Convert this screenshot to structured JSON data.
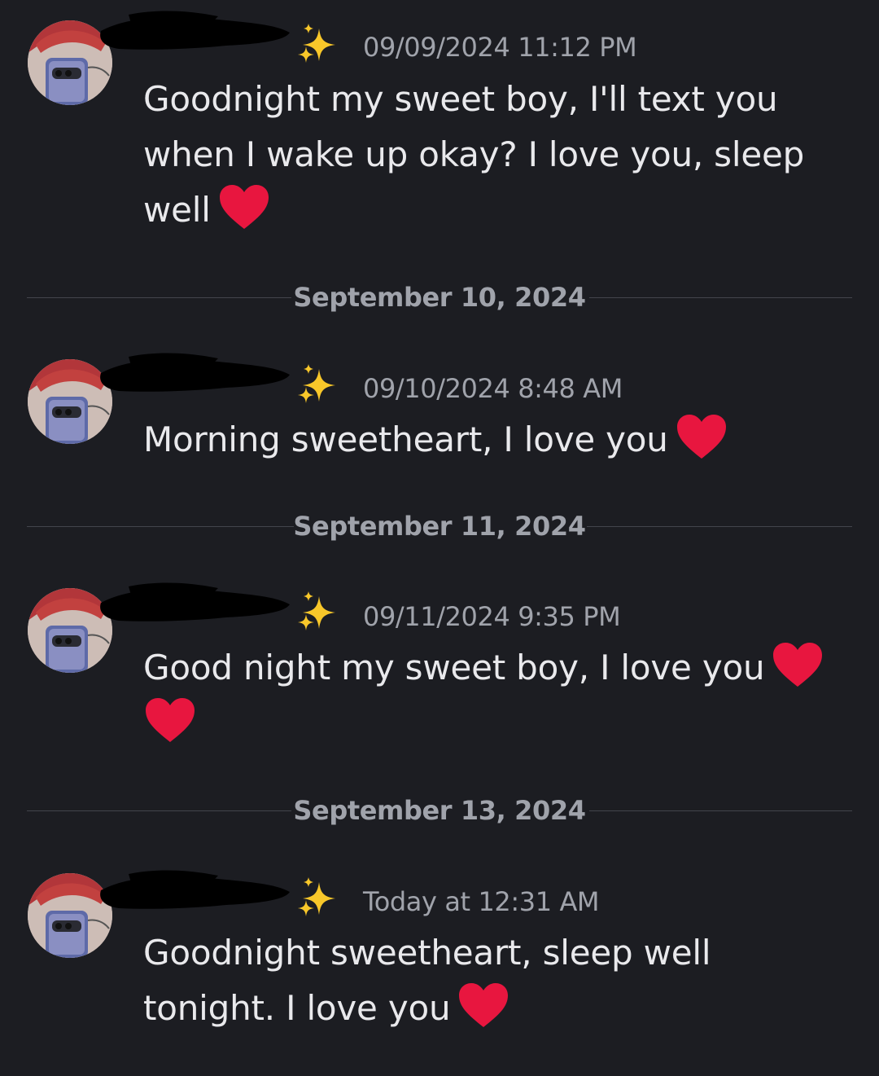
{
  "messages": [
    {
      "timestamp": "09/09/2024 11:12 PM",
      "text": "Goodnight my sweet boy, I'll text you when I wake up okay? I love you, sleep well",
      "hearts": 1
    },
    {
      "timestamp": "09/10/2024 8:48 AM",
      "text": "Morning sweetheart, I love you",
      "hearts": 1
    },
    {
      "timestamp": "09/11/2024 9:35 PM",
      "text": "Good night my sweet boy, I love you",
      "hearts": 2
    },
    {
      "timestamp": "Today at 12:31 AM",
      "text": "Goodnight sweetheart, sleep well tonight. I love you",
      "hearts": 1
    }
  ],
  "dividers": [
    "September 10, 2024",
    "September 11, 2024",
    "September 13, 2024"
  ],
  "icons": {
    "name_decoration": "sparkles-emoji",
    "reaction": "red-heart-emoji"
  },
  "colors": {
    "background": "#1c1d22",
    "message_text": "#e9e9ec",
    "muted_text": "#a0a3ab",
    "heart": "#e8163f",
    "sparkle": "#f8c72a"
  }
}
